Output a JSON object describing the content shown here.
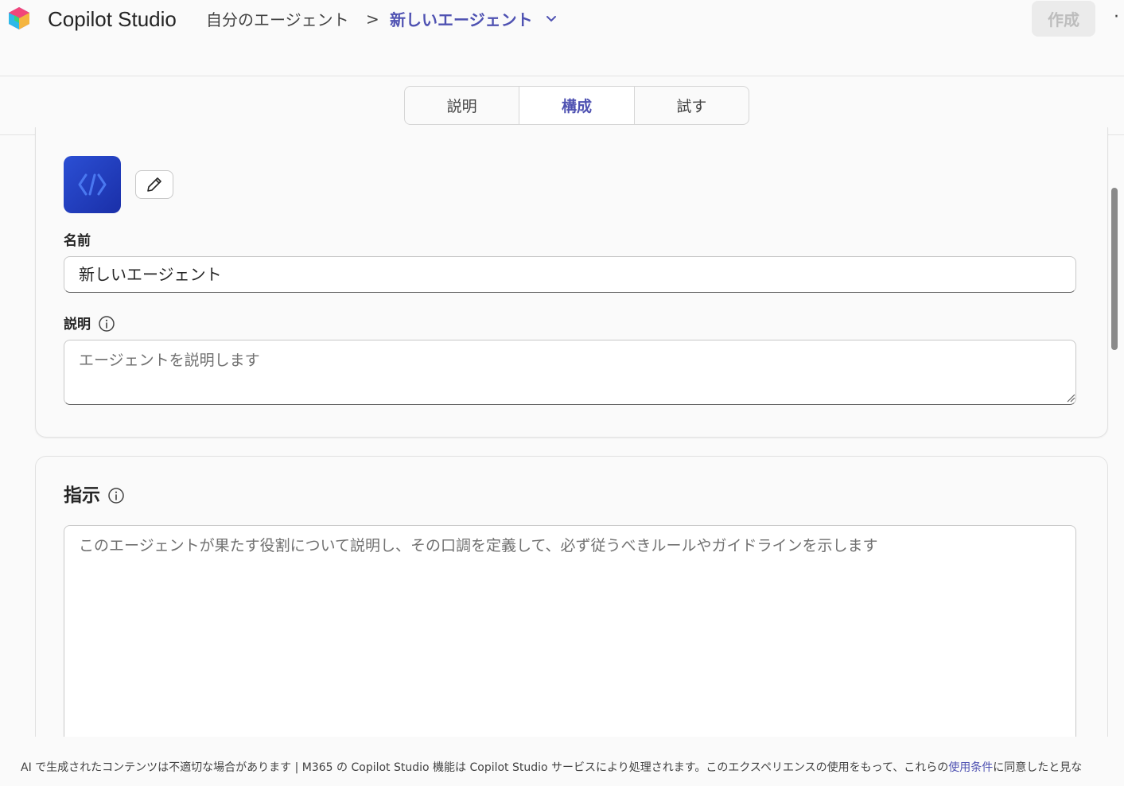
{
  "header": {
    "app_title": "Copilot Studio",
    "breadcrumb_parent": "自分のエージェント",
    "breadcrumb_separator": ">",
    "breadcrumb_current": "新しいエージェント",
    "create_label": "作成",
    "more_label": "·"
  },
  "tabs": [
    {
      "label": "説明",
      "active": false
    },
    {
      "label": "構成",
      "active": true
    },
    {
      "label": "試す",
      "active": false
    }
  ],
  "details": {
    "name_label": "名前",
    "name_value": "新しいエージェント",
    "description_label": "説明",
    "description_placeholder": "エージェントを説明します"
  },
  "instructions": {
    "title": "指示",
    "placeholder": "このエージェントが果たす役割について説明し、その口調を定義して、必ず従うべきルールやガイドラインを示します"
  },
  "footer": {
    "text_before_link": "AI で生成されたコンテンツは不適切な場合があります | M365 の Copilot Studio 機能は Copilot Studio サービスにより処理されます。このエクスペリエンスの使用をもって、これらの",
    "link_label": "使用条件",
    "text_after_link": "に同意したと見な"
  },
  "colors": {
    "accent": "#4f52b2",
    "avatar": "#2b4fd4",
    "background": "#fafafa"
  },
  "icons": {
    "logo": "copilot-studio-logo",
    "chevron": "chevron-down-icon",
    "edit": "pencil-icon",
    "info": "info-icon",
    "agent": "agent-code-icon"
  }
}
